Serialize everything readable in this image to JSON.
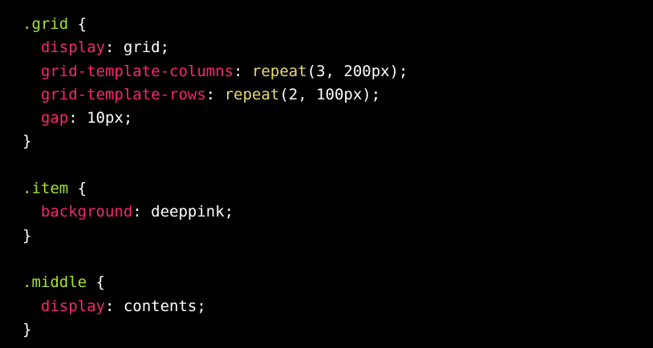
{
  "colors": {
    "background": "#000000",
    "selector": "#a6e22e",
    "property": "#f92672",
    "function": "#e6db74",
    "text": "#ffffff"
  },
  "code": {
    "grid_selector": ".grid",
    "grid_display_prop": "display",
    "grid_display_val": "grid",
    "grid_cols_prop": "grid-template-columns",
    "grid_cols_fn": "repeat",
    "grid_cols_args": "3, 200px",
    "grid_rows_prop": "grid-template-rows",
    "grid_rows_fn": "repeat",
    "grid_rows_args": "2, 100px",
    "grid_gap_prop": "gap",
    "grid_gap_val": "10px",
    "item_selector": ".item",
    "item_bg_prop": "background",
    "item_bg_val": "deeppink",
    "middle_selector": ".middle",
    "middle_display_prop": "display",
    "middle_display_val": "contents"
  }
}
